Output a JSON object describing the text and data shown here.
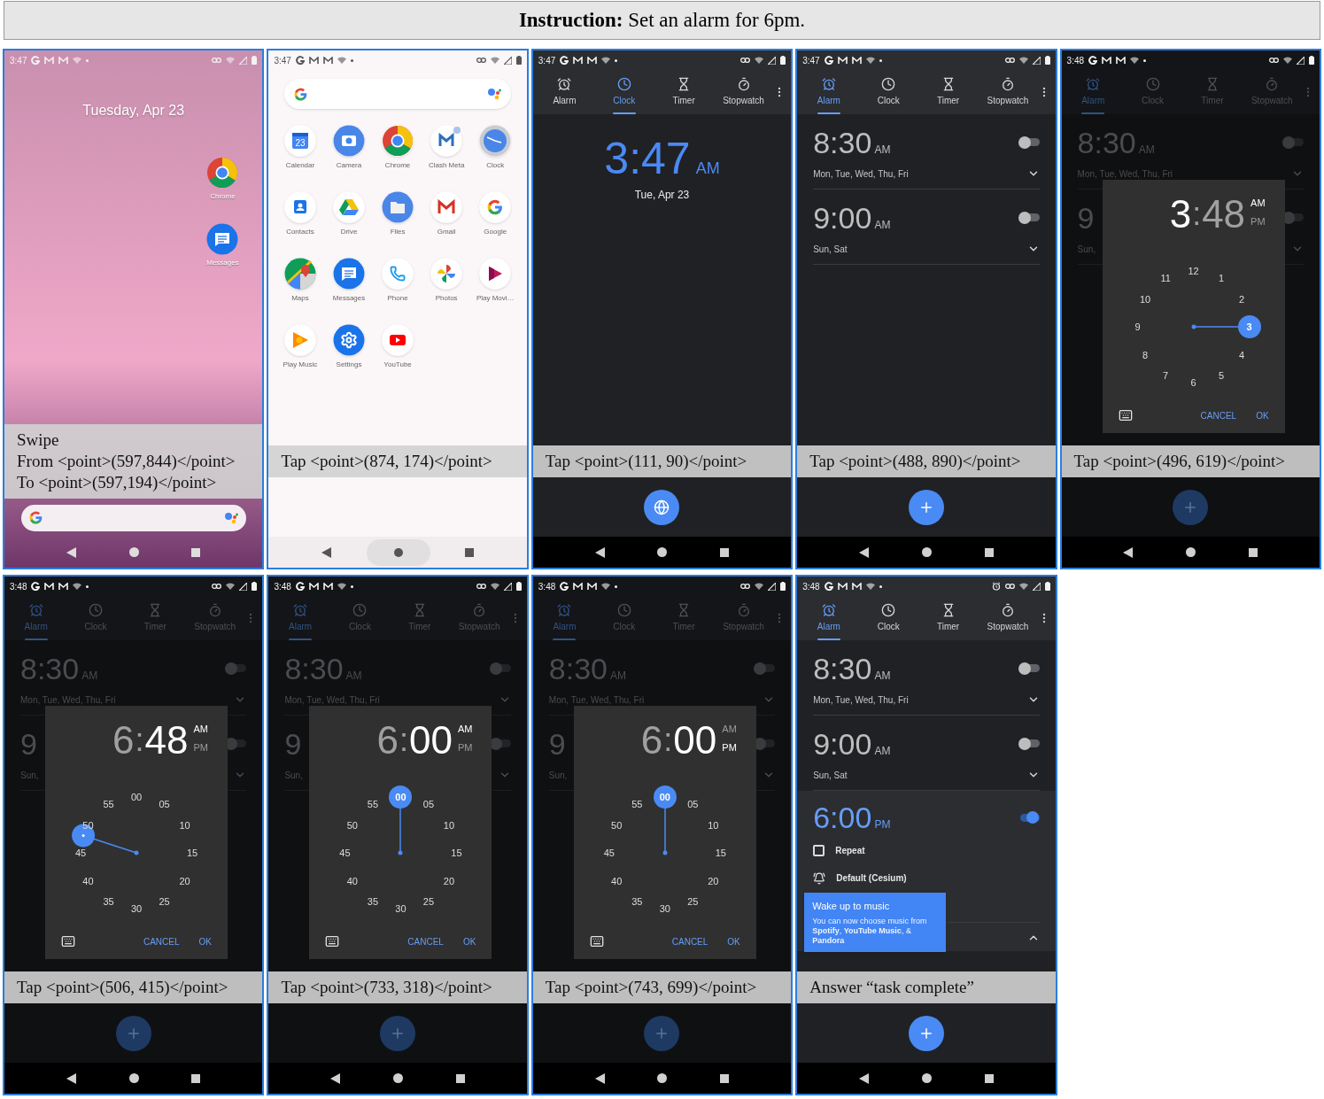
{
  "instruction": {
    "label": "Instruction:",
    "text": "Set an alarm for 6pm."
  },
  "panels": [
    {
      "kind": "home",
      "status_time": "3:47",
      "alarm_indicator": false,
      "date": "Tuesday, Apr 23",
      "apps": [
        {
          "kind": "chrome",
          "name": "Chrome"
        },
        {
          "kind": "messages",
          "name": "Messages"
        }
      ],
      "caption": [
        "Swipe",
        "From <point>(597,844)</point>",
        "To <point>(597,194)</point>"
      ]
    },
    {
      "kind": "drawer",
      "status_time": "3:47",
      "alarm_indicator": false,
      "apps": [
        {
          "kind": "calendar",
          "name": "Calendar",
          "badge": "23"
        },
        {
          "kind": "camera",
          "name": "Camera"
        },
        {
          "kind": "chrome",
          "name": "Chrome"
        },
        {
          "kind": "clashmeta",
          "name": "Clash Meta"
        },
        {
          "kind": "clock",
          "name": "Clock"
        },
        {
          "kind": "contacts",
          "name": "Contacts"
        },
        {
          "kind": "drive",
          "name": "Drive"
        },
        {
          "kind": "files",
          "name": "Files"
        },
        {
          "kind": "gmail",
          "name": "Gmail"
        },
        {
          "kind": "google",
          "name": "Google"
        },
        {
          "kind": "maps",
          "name": "Maps"
        },
        {
          "kind": "messages",
          "name": "Messages"
        },
        {
          "kind": "phone",
          "name": "Phone"
        },
        {
          "kind": "photos",
          "name": "Photos"
        },
        {
          "kind": "playmovies",
          "name": "Play Movi…"
        },
        {
          "kind": "playmusic",
          "name": "Play Music"
        },
        {
          "kind": "settings",
          "name": "Settings"
        },
        {
          "kind": "youtube",
          "name": "YouTube"
        }
      ],
      "caption": [
        "Tap <point>(874, 174)</point>"
      ]
    },
    {
      "kind": "clock",
      "status_time": "3:47",
      "alarm_indicator": false,
      "tabs": [
        {
          "kind": "alarm",
          "label": "Alarm",
          "selected": false
        },
        {
          "kind": "clock",
          "label": "Clock",
          "selected": true
        },
        {
          "kind": "timer",
          "label": "Timer",
          "selected": false
        },
        {
          "kind": "stopwatch",
          "label": "Stopwatch",
          "selected": false
        }
      ],
      "time": "3:47",
      "ampm": "AM",
      "date": "Tue, Apr 23",
      "fab": {
        "kind": "globe"
      },
      "caption": [
        "Tap <point>(111, 90)</point>"
      ]
    },
    {
      "kind": "alarms",
      "status_time": "3:47",
      "alarm_indicator": false,
      "tabs": [
        {
          "kind": "alarm",
          "label": "Alarm",
          "selected": true
        },
        {
          "kind": "clock",
          "label": "Clock",
          "selected": false
        },
        {
          "kind": "timer",
          "label": "Timer",
          "selected": false
        },
        {
          "kind": "stopwatch",
          "label": "Stopwatch",
          "selected": false
        }
      ],
      "alarms": [
        {
          "time": "8:30",
          "ampm": "AM",
          "days": "Mon, Tue, Wed, Thu, Fri",
          "on": false,
          "expanded": false
        },
        {
          "time": "9:00",
          "ampm": "AM",
          "days": "Sun, Sat",
          "on": false,
          "expanded": false
        }
      ],
      "fab": {
        "kind": "plus"
      },
      "caption": [
        "Tap <point>(488, 890)</point>"
      ]
    },
    {
      "kind": "picker",
      "status_time": "3:48",
      "alarm_indicator": false,
      "tabs": [
        {
          "kind": "alarm",
          "label": "Alarm",
          "selected": true
        },
        {
          "kind": "clock",
          "label": "Clock",
          "selected": false
        },
        {
          "kind": "timer",
          "label": "Timer",
          "selected": false
        },
        {
          "kind": "stopwatch",
          "label": "Stopwatch",
          "selected": false
        }
      ],
      "alarms": [
        {
          "time": "8:30",
          "ampm": "AM",
          "days": "Mon, Tue, Wed, Thu, Fri",
          "on": false,
          "expanded": false
        },
        {
          "time": "9",
          "days": "Sun,",
          "on": false,
          "expanded": false
        }
      ],
      "picker": {
        "hour": {
          "text": "3",
          "selected": true
        },
        "separator": ":",
        "minute": {
          "text": "48",
          "selected": false
        },
        "periods": [
          {
            "label": "AM",
            "selected": true
          },
          {
            "label": "PM",
            "selected": false
          }
        ],
        "dial": [
          {
            "label": "12",
            "selected": false
          },
          {
            "label": "1",
            "selected": false
          },
          {
            "label": "2",
            "selected": false
          },
          {
            "label": "3",
            "selected": true
          },
          {
            "label": "4",
            "selected": false
          },
          {
            "label": "5",
            "selected": false
          },
          {
            "label": "6",
            "selected": false
          },
          {
            "label": "7",
            "selected": false
          },
          {
            "label": "8",
            "selected": false
          },
          {
            "label": "9",
            "selected": false
          },
          {
            "label": "10",
            "selected": false
          },
          {
            "label": "11",
            "selected": false
          }
        ],
        "cancel": "CANCEL",
        "ok": "OK"
      },
      "fab": {
        "kind": "plus"
      },
      "caption": [
        "Tap <point>(496, 619)</point>"
      ]
    },
    {
      "kind": "picker",
      "status_time": "3:48",
      "alarm_indicator": false,
      "tabs": [
        {
          "kind": "alarm",
          "label": "Alarm",
          "selected": true
        },
        {
          "kind": "clock",
          "label": "Clock",
          "selected": false
        },
        {
          "kind": "timer",
          "label": "Timer",
          "selected": false
        },
        {
          "kind": "stopwatch",
          "label": "Stopwatch",
          "selected": false
        }
      ],
      "alarms": [
        {
          "time": "8:30",
          "ampm": "AM",
          "days": "Mon, Tue, Wed, Thu, Fri",
          "on": false,
          "expanded": false
        },
        {
          "time": "9",
          "days": "Sun,",
          "on": false,
          "expanded": false
        }
      ],
      "picker": {
        "hour": {
          "text": "6",
          "selected": false
        },
        "separator": ":",
        "minute": {
          "text": "48",
          "selected": true
        },
        "periods": [
          {
            "label": "AM",
            "selected": true
          },
          {
            "label": "PM",
            "selected": false
          }
        ],
        "dial": [
          {
            "label": "00",
            "selected": false
          },
          {
            "label": "05",
            "selected": false
          },
          {
            "label": "10",
            "selected": false
          },
          {
            "label": "15",
            "selected": false
          },
          {
            "label": "20",
            "selected": false
          },
          {
            "label": "25",
            "selected": false
          },
          {
            "label": "30",
            "selected": false
          },
          {
            "label": "35",
            "selected": false
          },
          {
            "label": "40",
            "selected": false
          },
          {
            "label": "45",
            "selected": false
          },
          {
            "label": "50",
            "selected": false
          },
          {
            "label": "55",
            "selected": false
          }
        ],
        "cancel": "CANCEL",
        "ok": "OK"
      },
      "fab": {
        "kind": "plus"
      },
      "caption": [
        "Tap <point>(506, 415)</point>"
      ]
    },
    {
      "kind": "picker",
      "status_time": "3:48",
      "alarm_indicator": false,
      "tabs": [
        {
          "kind": "alarm",
          "label": "Alarm",
          "selected": true
        },
        {
          "kind": "clock",
          "label": "Clock",
          "selected": false
        },
        {
          "kind": "timer",
          "label": "Timer",
          "selected": false
        },
        {
          "kind": "stopwatch",
          "label": "Stopwatch",
          "selected": false
        }
      ],
      "alarms": [
        {
          "time": "8:30",
          "ampm": "AM",
          "days": "Mon, Tue, Wed, Thu, Fri",
          "on": false,
          "expanded": false
        },
        {
          "time": "9",
          "days": "Sun,",
          "on": false,
          "expanded": false
        }
      ],
      "picker": {
        "hour": {
          "text": "6",
          "selected": false
        },
        "separator": ":",
        "minute": {
          "text": "00",
          "selected": true
        },
        "periods": [
          {
            "label": "AM",
            "selected": true
          },
          {
            "label": "PM",
            "selected": false
          }
        ],
        "dial": [
          {
            "label": "00",
            "selected": true
          },
          {
            "label": "05",
            "selected": false
          },
          {
            "label": "10",
            "selected": false
          },
          {
            "label": "15",
            "selected": false
          },
          {
            "label": "20",
            "selected": false
          },
          {
            "label": "25",
            "selected": false
          },
          {
            "label": "30",
            "selected": false
          },
          {
            "label": "35",
            "selected": false
          },
          {
            "label": "40",
            "selected": false
          },
          {
            "label": "45",
            "selected": false
          },
          {
            "label": "50",
            "selected": false
          },
          {
            "label": "55",
            "selected": false
          }
        ],
        "cancel": "CANCEL",
        "ok": "OK"
      },
      "fab": {
        "kind": "plus"
      },
      "caption": [
        "Tap <point>(733, 318)</point>"
      ]
    },
    {
      "kind": "picker",
      "status_time": "3:48",
      "alarm_indicator": false,
      "tabs": [
        {
          "kind": "alarm",
          "label": "Alarm",
          "selected": true
        },
        {
          "kind": "clock",
          "label": "Clock",
          "selected": false
        },
        {
          "kind": "timer",
          "label": "Timer",
          "selected": false
        },
        {
          "kind": "stopwatch",
          "label": "Stopwatch",
          "selected": false
        }
      ],
      "alarms": [
        {
          "time": "8:30",
          "ampm": "AM",
          "days": "Mon, Tue, Wed, Thu, Fri",
          "on": false,
          "expanded": false
        },
        {
          "time": "9",
          "days": "Sun,",
          "on": false,
          "expanded": false
        }
      ],
      "picker": {
        "hour": {
          "text": "6",
          "selected": false
        },
        "separator": ":",
        "minute": {
          "text": "00",
          "selected": true
        },
        "periods": [
          {
            "label": "AM",
            "selected": false
          },
          {
            "label": "PM",
            "selected": true
          }
        ],
        "dial": [
          {
            "label": "00",
            "selected": true
          },
          {
            "label": "05",
            "selected": false
          },
          {
            "label": "10",
            "selected": false
          },
          {
            "label": "15",
            "selected": false
          },
          {
            "label": "20",
            "selected": false
          },
          {
            "label": "25",
            "selected": false
          },
          {
            "label": "30",
            "selected": false
          },
          {
            "label": "35",
            "selected": false
          },
          {
            "label": "40",
            "selected": false
          },
          {
            "label": "45",
            "selected": false
          },
          {
            "label": "50",
            "selected": false
          },
          {
            "label": "55",
            "selected": false
          }
        ],
        "cancel": "CANCEL",
        "ok": "OK"
      },
      "fab": {
        "kind": "plus"
      },
      "caption": [
        "Tap <point>(743, 699)</point>"
      ]
    },
    {
      "kind": "alarms",
      "status_time": "3:48",
      "alarm_indicator": true,
      "tabs": [
        {
          "kind": "alarm",
          "label": "Alarm",
          "selected": true
        },
        {
          "kind": "clock",
          "label": "Clock",
          "selected": false
        },
        {
          "kind": "timer",
          "label": "Timer",
          "selected": false
        },
        {
          "kind": "stopwatch",
          "label": "Stopwatch",
          "selected": false
        }
      ],
      "alarms": [
        {
          "time": "8:30",
          "ampm": "AM",
          "days": "Mon, Tue, Wed, Thu, Fri",
          "on": false,
          "expanded": false
        },
        {
          "time": "9:00",
          "ampm": "AM",
          "days": "Sun, Sat",
          "on": false,
          "expanded": false
        },
        {
          "time": "6:00",
          "ampm": "PM",
          "on": true,
          "expanded": true,
          "repeat": {
            "label": "Repeat",
            "checked": false
          },
          "ringtone": "Default (Cesium)"
        }
      ],
      "tooltip": {
        "title": "Wake up to music",
        "body": "You can now choose music from **Spotify**, **YouTube Music**, & **Pandora**"
      },
      "fab": {
        "kind": "plus"
      },
      "caption": [
        "Answer “task complete”"
      ]
    }
  ]
}
